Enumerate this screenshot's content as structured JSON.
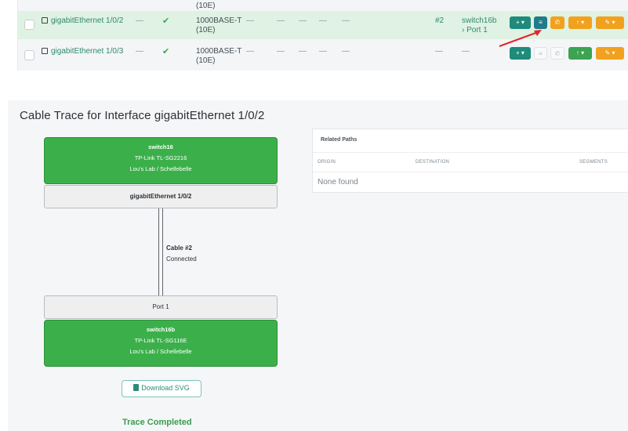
{
  "interfaces": {
    "partial_top": {
      "type_tail": "(10E)"
    },
    "rows": [
      {
        "name": "gigabitEthernet 1/0/2",
        "lag": "—",
        "enabled": "✔",
        "type": "1000BASE-T",
        "type_sub": "(10E)",
        "dashes": [
          "—",
          "—",
          "—",
          "—",
          "—"
        ],
        "cable": "#2",
        "peer_device": "switch16b",
        "peer_port": "› Port 1",
        "highlighted": true
      },
      {
        "name": "gigabitEthernet 1/0/3",
        "lag": "—",
        "enabled": "✔",
        "type": "1000BASE-T",
        "type_sub": "(10E)",
        "dashes": [
          "—",
          "—",
          "—",
          "—",
          "—"
        ],
        "cable": "—",
        "peer_device": "—",
        "peer_port": "",
        "highlighted": false
      }
    ],
    "action_icons": {
      "add": "plus-icon",
      "trace": "trace-icon",
      "connect": "phone-icon",
      "status": "arrow-icon",
      "edit": "pencil-icon",
      "dropdown": "chevron-down-icon"
    },
    "action_labels": {
      "add": "+ ▾",
      "trace": "≡",
      "connect": "✆",
      "status": "↑ ▾",
      "edit": "✎ ▾"
    }
  },
  "trace": {
    "title": "Cable Trace for Interface gigabitEthernet 1/0/2",
    "a_device": {
      "name": "switch16",
      "model": "TP-Link TL-SG2216",
      "site": "Lou's Lab / Schellebelle"
    },
    "a_port": "gigabitEthernet 1/0/2",
    "cable": {
      "label": "Cable #2",
      "status": "Connected"
    },
    "b_port": "Port 1",
    "b_device": {
      "name": "switch16b",
      "model": "TP-Link TL-SG116E",
      "site": "Lou's Lab / Schellebelle"
    },
    "download_label": "Download SVG",
    "status": "Trace Completed"
  },
  "related_paths": {
    "title": "Related Paths",
    "columns": [
      "ORIGIN",
      "DESTINATION",
      "SEGMENTS"
    ],
    "empty": "None found"
  },
  "colors": {
    "green_device": "#3bb04a",
    "teal": "#1e8b7c",
    "orange": "#f1a11e",
    "highlight_row": "#dff2e3",
    "annotation_arrow": "#e0262b"
  }
}
